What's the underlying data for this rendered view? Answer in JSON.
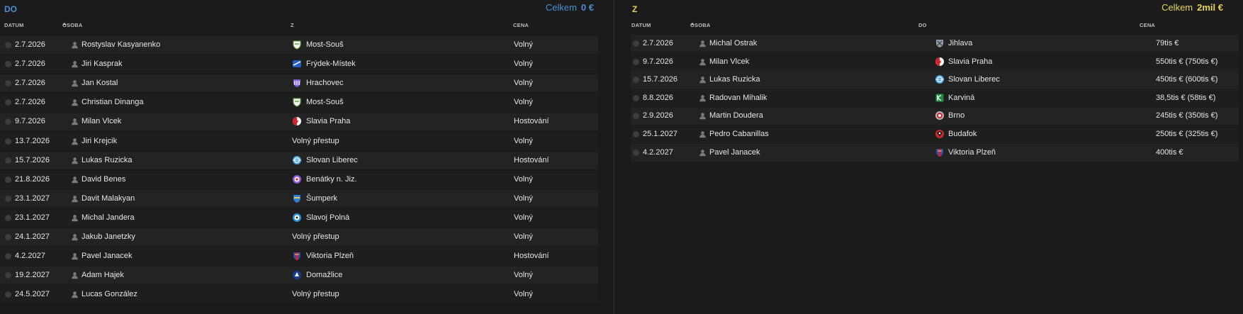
{
  "panels": {
    "in": {
      "title": "DO",
      "total_label": "Celkem",
      "total_value": "0 €",
      "title_color": "#4a8ed8",
      "total_color": "#4a8ed8",
      "columns": {
        "date": "DATUM",
        "person": "OSOBA",
        "club": "Z",
        "price": "CENA"
      },
      "rows": [
        {
          "date": "2.7.2026",
          "person": "Rostyslav Kasyanenko",
          "club": "Most-Souš",
          "crest": "most-sous-crest",
          "price": "Volný"
        },
        {
          "date": "2.7.2026",
          "person": "Jiri Kasprak",
          "club": "Frýdek-Místek",
          "crest": "frydek-mistek-crest",
          "price": "Volný"
        },
        {
          "date": "2.7.2026",
          "person": "Jan Kostal",
          "club": "Hrachovec",
          "crest": "hrachovec-crest",
          "price": "Volný"
        },
        {
          "date": "2.7.2026",
          "person": "Christian Dinanga",
          "club": "Most-Souš",
          "crest": "most-sous-crest",
          "price": "Volný"
        },
        {
          "date": "9.7.2026",
          "person": "Milan Vlcek",
          "club": "Slavia Praha",
          "crest": "slavia-praha-crest",
          "price": "Hostování"
        },
        {
          "date": "13.7.2026",
          "person": "Jiri Krejcik",
          "club": "Volný přestup",
          "crest": "",
          "price": "Volný"
        },
        {
          "date": "15.7.2026",
          "person": "Lukas Ruzicka",
          "club": "Slovan Liberec",
          "crest": "slovan-liberec-crest",
          "price": "Hostování"
        },
        {
          "date": "21.8.2026",
          "person": "David Benes",
          "club": "Benátky n. Jiz.",
          "crest": "benatky-crest",
          "price": "Volný"
        },
        {
          "date": "23.1.2027",
          "person": "Davit Malakyan",
          "club": "Šumperk",
          "crest": "sumperk-crest",
          "price": "Volný"
        },
        {
          "date": "23.1.2027",
          "person": "Michal Jandera",
          "club": "Slavoj Polná",
          "crest": "slavoj-polna-crest",
          "price": "Volný"
        },
        {
          "date": "24.1.2027",
          "person": "Jakub Janetzky",
          "club": "Volný přestup",
          "crest": "",
          "price": "Volný"
        },
        {
          "date": "4.2.2027",
          "person": "Pavel Janacek",
          "club": "Viktoria Plzeň",
          "crest": "viktoria-plzen-crest",
          "price": "Hostování"
        },
        {
          "date": "19.2.2027",
          "person": "Adam Hajek",
          "club": "Domažlice",
          "crest": "domazlice-crest",
          "price": "Volný"
        },
        {
          "date": "24.5.2027",
          "person": "Lucas González",
          "club": "Volný přestup",
          "crest": "",
          "price": "Volný"
        }
      ]
    },
    "out": {
      "title": "Z",
      "total_label": "Celkem",
      "total_value": "2mil €",
      "title_color": "#e8d45a",
      "total_color": "#e8d45a",
      "columns": {
        "date": "DATUM",
        "person": "OSOBA",
        "club": "DO",
        "price": "CENA"
      },
      "rows": [
        {
          "date": "2.7.2026",
          "person": "Michal Ostrak",
          "club": "Jihlava",
          "crest": "jihlava-crest",
          "price": "79tis €"
        },
        {
          "date": "9.7.2026",
          "person": "Milan Vlcek",
          "club": "Slavia Praha",
          "crest": "slavia-praha-crest",
          "price": "550tis € (750tis €)"
        },
        {
          "date": "15.7.2026",
          "person": "Lukas Ruzicka",
          "club": "Slovan Liberec",
          "crest": "slovan-liberec-crest",
          "price": "450tis € (600tis €)"
        },
        {
          "date": "8.8.2026",
          "person": "Radovan Mihalik",
          "club": "Karviná",
          "crest": "karvina-crest",
          "price": "38,5tis € (58tis €)"
        },
        {
          "date": "2.9.2026",
          "person": "Martin Doudera",
          "club": "Brno",
          "crest": "brno-crest",
          "price": "245tis € (350tis €)"
        },
        {
          "date": "25.1.2027",
          "person": "Pedro Cabanillas",
          "club": "Budafok",
          "crest": "budafok-crest",
          "price": "250tis € (325tis €)"
        },
        {
          "date": "4.2.2027",
          "person": "Pavel Janacek",
          "club": "Viktoria Plzeň",
          "crest": "viktoria-plzen-crest",
          "price": "400tis €"
        }
      ]
    }
  },
  "colors": {
    "row_odd": "#232323",
    "row_even": "#1e1e1e",
    "text": "#e6e6e6"
  }
}
